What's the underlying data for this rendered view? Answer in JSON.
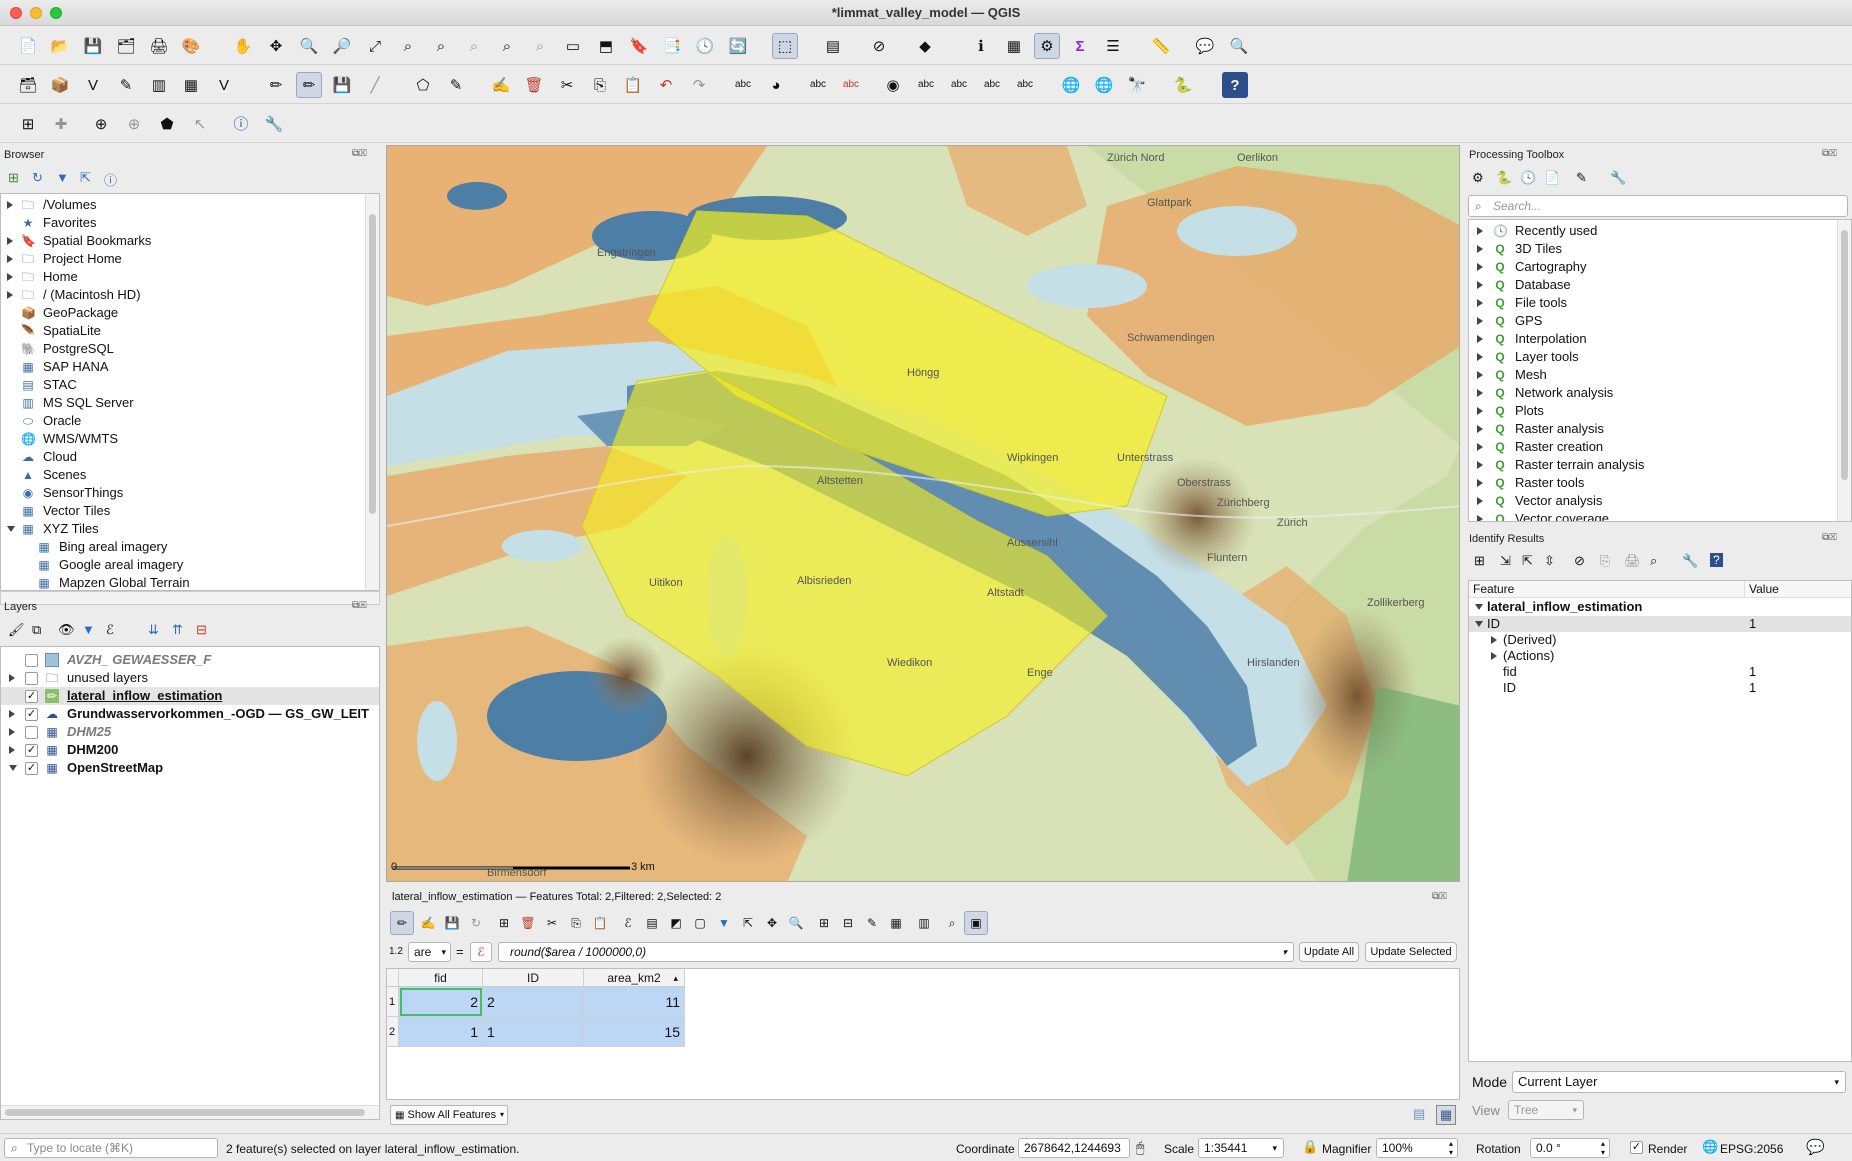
{
  "window": {
    "title": "*limmat_valley_model — QGIS"
  },
  "browser": {
    "title": "Browser",
    "items": [
      {
        "label": "/Volumes",
        "icon": "folder-icon",
        "arrow": "right",
        "indent": 0
      },
      {
        "label": "Favorites",
        "icon": "star-icon",
        "arrow": "none",
        "indent": 0
      },
      {
        "label": "Spatial Bookmarks",
        "icon": "bookmark-icon",
        "arrow": "right",
        "indent": 0
      },
      {
        "label": "Project Home",
        "icon": "folder-icon",
        "arrow": "right",
        "indent": 0
      },
      {
        "label": "Home",
        "icon": "folder-icon",
        "arrow": "right",
        "indent": 0
      },
      {
        "label": "/ (Macintosh HD)",
        "icon": "folder-icon",
        "arrow": "right",
        "indent": 0
      },
      {
        "label": "GeoPackage",
        "icon": "geopackage-icon",
        "arrow": "none",
        "indent": 0
      },
      {
        "label": "SpatiaLite",
        "icon": "spatialite-icon",
        "arrow": "none",
        "indent": 0
      },
      {
        "label": "PostgreSQL",
        "icon": "postgresql-icon",
        "arrow": "none",
        "indent": 0
      },
      {
        "label": "SAP HANA",
        "icon": "sap-hana-icon",
        "arrow": "none",
        "indent": 0
      },
      {
        "label": "STAC",
        "icon": "stac-icon",
        "arrow": "none",
        "indent": 0
      },
      {
        "label": "MS SQL Server",
        "icon": "mssql-icon",
        "arrow": "none",
        "indent": 0
      },
      {
        "label": "Oracle",
        "icon": "oracle-icon",
        "arrow": "none",
        "indent": 0
      },
      {
        "label": "WMS/WMTS",
        "icon": "wms-icon",
        "arrow": "none",
        "indent": 0
      },
      {
        "label": "Cloud",
        "icon": "cloud-icon",
        "arrow": "none",
        "indent": 0
      },
      {
        "label": "Scenes",
        "icon": "scenes-icon",
        "arrow": "none",
        "indent": 0
      },
      {
        "label": "SensorThings",
        "icon": "sensor-icon",
        "arrow": "none",
        "indent": 0
      },
      {
        "label": "Vector Tiles",
        "icon": "vector-tiles-icon",
        "arrow": "none",
        "indent": 0
      },
      {
        "label": "XYZ Tiles",
        "icon": "xyz-tiles-icon",
        "arrow": "down",
        "indent": 0
      },
      {
        "label": "Bing areal imagery",
        "icon": "xyz-tiles-icon",
        "arrow": "none",
        "indent": 1
      },
      {
        "label": "Google areal imagery",
        "icon": "xyz-tiles-icon",
        "arrow": "none",
        "indent": 1
      },
      {
        "label": "Mapzen Global Terrain",
        "icon": "xyz-tiles-icon",
        "arrow": "none",
        "indent": 1
      }
    ]
  },
  "layers": {
    "title": "Layers",
    "items": [
      {
        "label": "AVZH_ GEWAESSER_F",
        "checked": false,
        "arrow": "none",
        "style": "italic-bold-grey",
        "icon": "polygon-layer-icon"
      },
      {
        "label": "unused layers",
        "checked": false,
        "arrow": "right",
        "style": "normal",
        "icon": "group-icon"
      },
      {
        "label": "lateral_inflow_estimation",
        "checked": true,
        "arrow": "none",
        "style": "bold-underline",
        "icon": "editable-layer-icon"
      },
      {
        "label": "Grundwasservorkommen_-OGD — GS_GW_LEIT",
        "checked": true,
        "arrow": "right",
        "style": "bold",
        "icon": "wms-layer-icon"
      },
      {
        "label": "DHM25",
        "checked": false,
        "arrow": "right",
        "style": "italic-bold-grey",
        "icon": "raster-layer-icon"
      },
      {
        "label": "DHM200",
        "checked": true,
        "arrow": "right",
        "style": "bold",
        "icon": "raster-layer-icon"
      },
      {
        "label": "OpenStreetMap",
        "checked": true,
        "arrow": "down",
        "style": "bold",
        "icon": "raster-layer-icon"
      }
    ]
  },
  "map": {
    "scale_left": "0",
    "scale_right": "3 km",
    "place_labels": [
      "Zürich Nord",
      "Glattpark",
      "Schwamendingen",
      "Höngg",
      "Wipkingen",
      "Unterstrass",
      "Oberstrass",
      "Altstetten",
      "Aussersihl",
      "Fluntern",
      "Zürichberg",
      "Zürich",
      "Albisrieden",
      "Uitikon",
      "Engstringen",
      "Birmensdorf",
      "Enge",
      "Hirslanden",
      "Wiedikon",
      "Altstadt",
      "Oerlikon",
      "Zollikerberg"
    ]
  },
  "attribute_table": {
    "title": "lateral_inflow_estimation — Features Total: 2,Filtered: 2,Selected: 2",
    "field_type": "1.2",
    "field_name": "are",
    "equals": "=",
    "expression": "round($area / 1000000,0)",
    "update_all": "Update All",
    "update_selected": "Update Selected",
    "columns": [
      "fid",
      "ID",
      "area_km2"
    ],
    "rows": [
      {
        "num": "1",
        "fid": "2",
        "id": "2",
        "area": "11"
      },
      {
        "num": "2",
        "fid": "1",
        "id": "1",
        "area": "15"
      }
    ],
    "show_all": "Show All Features"
  },
  "processing": {
    "title": "Processing Toolbox",
    "search_placeholder": "Search...",
    "items": [
      "Recently used",
      "3D Tiles",
      "Cartography",
      "Database",
      "File tools",
      "GPS",
      "Interpolation",
      "Layer tools",
      "Mesh",
      "Network analysis",
      "Plots",
      "Raster analysis",
      "Raster creation",
      "Raster terrain analysis",
      "Raster tools",
      "Vector analysis",
      "Vector coverage"
    ]
  },
  "identify": {
    "title": "Identify Results",
    "col_feature": "Feature",
    "col_value": "Value",
    "layer": "lateral_inflow_estimation",
    "rows": [
      {
        "label": "ID",
        "value": "1",
        "indent": 1,
        "arrow": "down",
        "highlight": true
      },
      {
        "label": "(Derived)",
        "value": "",
        "indent": 2,
        "arrow": "right",
        "highlight": false
      },
      {
        "label": "(Actions)",
        "value": "",
        "indent": 2,
        "arrow": "right",
        "highlight": false
      },
      {
        "label": "fid",
        "value": "1",
        "indent": 2,
        "arrow": "none",
        "highlight": false
      },
      {
        "label": "ID",
        "value": "1",
        "indent": 2,
        "arrow": "none",
        "highlight": false
      }
    ],
    "mode_label": "Mode",
    "mode_value": "Current Layer",
    "view_label": "View",
    "view_value": "Tree"
  },
  "status": {
    "locate_placeholder": "Type to locate (⌘K)",
    "message": "2 feature(s) selected on layer lateral_inflow_estimation.",
    "coord_label": "Coordinate",
    "coord_value": "2678642,1244693",
    "scale_label": "Scale",
    "scale_value": "1:35441",
    "magnifier_label": "Magnifier",
    "magnifier_value": "100%",
    "rotation_label": "Rotation",
    "rotation_value": "0.0 °",
    "render_label": "Render",
    "crs": "EPSG:2056"
  },
  "colors": {
    "selection_yellow": "#f5ef1f",
    "groundwater_blue": "#4d7fa6",
    "orange": "#e9a968",
    "highlight_blue": "#bcd6f5"
  }
}
